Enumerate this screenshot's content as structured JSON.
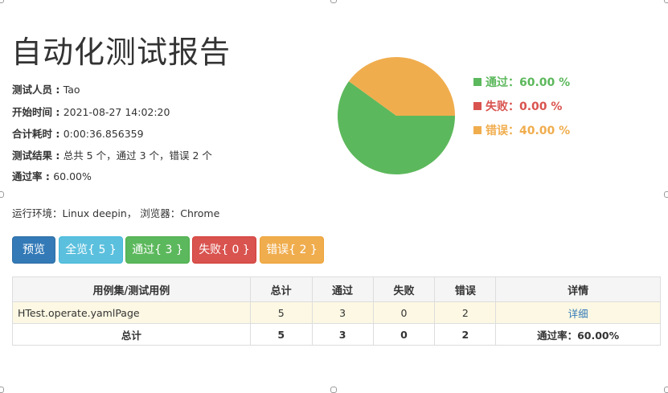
{
  "title": "自动化测试报告",
  "info": [
    {
      "label": "测试人员 : ",
      "value": "Tao"
    },
    {
      "label": "开始时间 : ",
      "value": "2021-08-27 14:02:20"
    },
    {
      "label": "合计耗时 : ",
      "value": "0:00:36.856359"
    },
    {
      "label": "测试结果 : ",
      "value": "总共 5 个，通过 3 个，错误 2 个"
    },
    {
      "label": "通过率 : ",
      "value": "60.00%"
    }
  ],
  "environment": "运行环境：Linux deepin， 浏览器：Chrome",
  "legend": [
    {
      "label": "通过：60.00 %",
      "color": "#5cb85c"
    },
    {
      "label": "失败：0.00 %",
      "color": "#d9534f"
    },
    {
      "label": "错误：40.00 %",
      "color": "#f0ad4e"
    }
  ],
  "chart_data": {
    "type": "pie",
    "labels": [
      "通过",
      "失败",
      "错误"
    ],
    "values": [
      60.0,
      0.0,
      40.0
    ],
    "colors": [
      "#5cb85c",
      "#d9534f",
      "#f0ad4e"
    ]
  },
  "buttons": {
    "preview": "预览",
    "all": "全览{ 5 }",
    "pass": "通过{ 3 }",
    "fail": "失败{ 0 }",
    "error": "错误{ 2 }"
  },
  "table": {
    "headers": [
      "用例集/测试用例",
      "总计",
      "通过",
      "失败",
      "错误",
      "详情"
    ],
    "row": {
      "name": "HTest.operate.yamlPage",
      "total": "5",
      "pass": "3",
      "fail": "0",
      "error": "2",
      "detail": "详细"
    },
    "summary": {
      "label": "总计",
      "total": "5",
      "pass": "3",
      "fail": "0",
      "error": "2",
      "rate": "通过率：60.00%"
    }
  }
}
